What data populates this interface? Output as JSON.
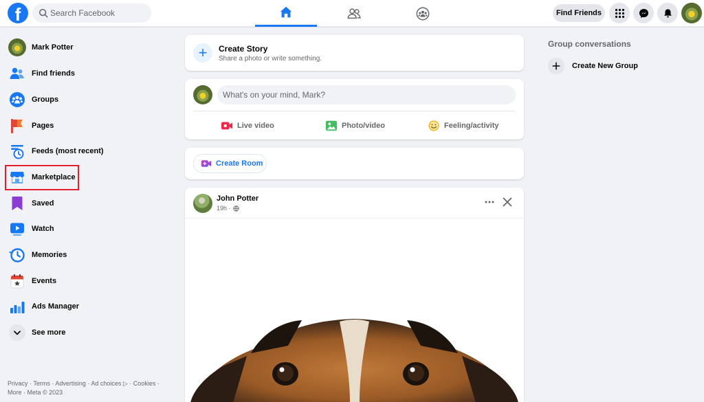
{
  "header": {
    "logo_letter": "f",
    "search_placeholder": "Search Facebook",
    "nav_tabs": [
      {
        "name": "home",
        "icon": "home-icon",
        "active": true
      },
      {
        "name": "friends",
        "icon": "friends-icon",
        "active": false
      },
      {
        "name": "groups",
        "icon": "groups-icon",
        "active": false
      }
    ],
    "find_friends_label": "Find Friends",
    "buttons": [
      "menu-grid-icon",
      "messenger-icon",
      "notifications-bell-icon"
    ]
  },
  "sidebar": {
    "items": [
      {
        "label": "Mark Potter",
        "icon": "profile-avatar"
      },
      {
        "label": "Find friends",
        "icon": "find-friends-icon"
      },
      {
        "label": "Groups",
        "icon": "groups-icon"
      },
      {
        "label": "Pages",
        "icon": "pages-flag-icon"
      },
      {
        "label": "Feeds (most recent)",
        "icon": "feeds-clock-icon"
      },
      {
        "label": "Marketplace",
        "icon": "marketplace-shop-icon"
      },
      {
        "label": "Saved",
        "icon": "saved-bookmark-icon"
      },
      {
        "label": "Watch",
        "icon": "watch-play-icon"
      },
      {
        "label": "Memories",
        "icon": "memories-clock-icon"
      },
      {
        "label": "Events",
        "icon": "events-calendar-icon"
      },
      {
        "label": "Ads Manager",
        "icon": "ads-manager-chart-icon"
      },
      {
        "label": "See more",
        "icon": "chevron-down-icon"
      }
    ],
    "footer_line1": "Privacy · Terms · Advertising · Ad choices ▷ · Cookies ·",
    "footer_line2": "More · Meta © 2023"
  },
  "feed": {
    "story": {
      "title": "Create Story",
      "subtitle": "Share a photo or write something."
    },
    "composer": {
      "placeholder": "What's on your mind, Mark?",
      "actions": [
        {
          "label": "Live video",
          "icon": "live-video-icon",
          "color": "#f02849"
        },
        {
          "label": "Photo/video",
          "icon": "photo-video-icon",
          "color": "#45bd62"
        },
        {
          "label": "Feeling/activity",
          "icon": "feeling-emoji-icon",
          "color": "#f7b928"
        }
      ]
    },
    "room": {
      "label": "Create Room"
    },
    "post": {
      "author": "John Potter",
      "time": "19h ·"
    }
  },
  "right": {
    "heading": "Group conversations",
    "new_group_label": "Create New Group"
  },
  "colors": {
    "brand": "#1877f2",
    "highlight": "#e41e2b",
    "background": "#f0f2f5"
  }
}
